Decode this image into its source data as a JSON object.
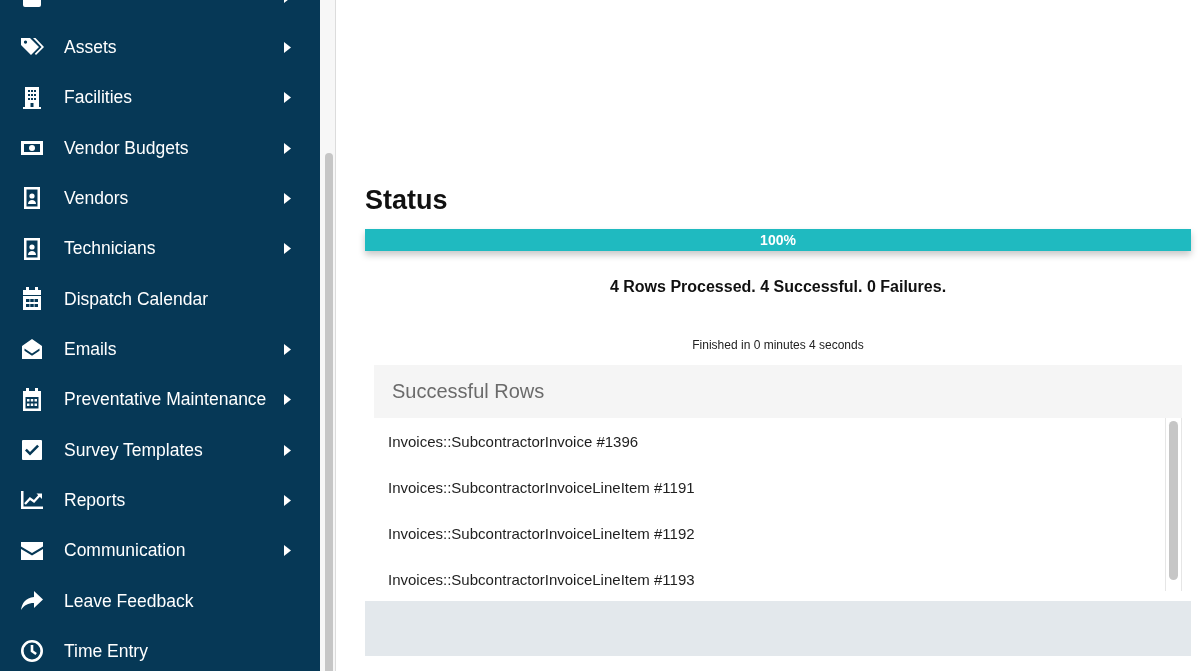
{
  "sidebar": {
    "items": [
      {
        "has_submenu": true
      },
      {
        "label": "Assets",
        "has_submenu": true
      },
      {
        "label": "Facilities",
        "has_submenu": true
      },
      {
        "label": "Vendor Budgets",
        "has_submenu": true
      },
      {
        "label": "Vendors",
        "has_submenu": true
      },
      {
        "label": "Technicians",
        "has_submenu": true
      },
      {
        "label": "Dispatch Calendar",
        "has_submenu": false
      },
      {
        "label": "Emails",
        "has_submenu": true
      },
      {
        "label": "Preventative Maintenance",
        "has_submenu": true
      },
      {
        "label": "Survey Templates",
        "has_submenu": true
      },
      {
        "label": "Reports",
        "has_submenu": true
      },
      {
        "label": "Communication",
        "has_submenu": true
      },
      {
        "label": "Leave Feedback",
        "has_submenu": false
      },
      {
        "label": "Time Entry",
        "has_submenu": false
      }
    ]
  },
  "status": {
    "title": "Status",
    "progress": {
      "level": 1,
      "label": "100%"
    },
    "summary": "4 Rows Processed. 4 Successful. 0 Failures.",
    "duration": "Finished in 0 minutes 4 seconds"
  },
  "successful_rows": {
    "title": "Successful Rows",
    "rows": [
      "Invoices::SubcontractorInvoice #1396",
      "Invoices::SubcontractorInvoiceLineItem #1191",
      "Invoices::SubcontractorInvoiceLineItem #1192",
      "Invoices::SubcontractorInvoiceLineItem #1193"
    ]
  }
}
